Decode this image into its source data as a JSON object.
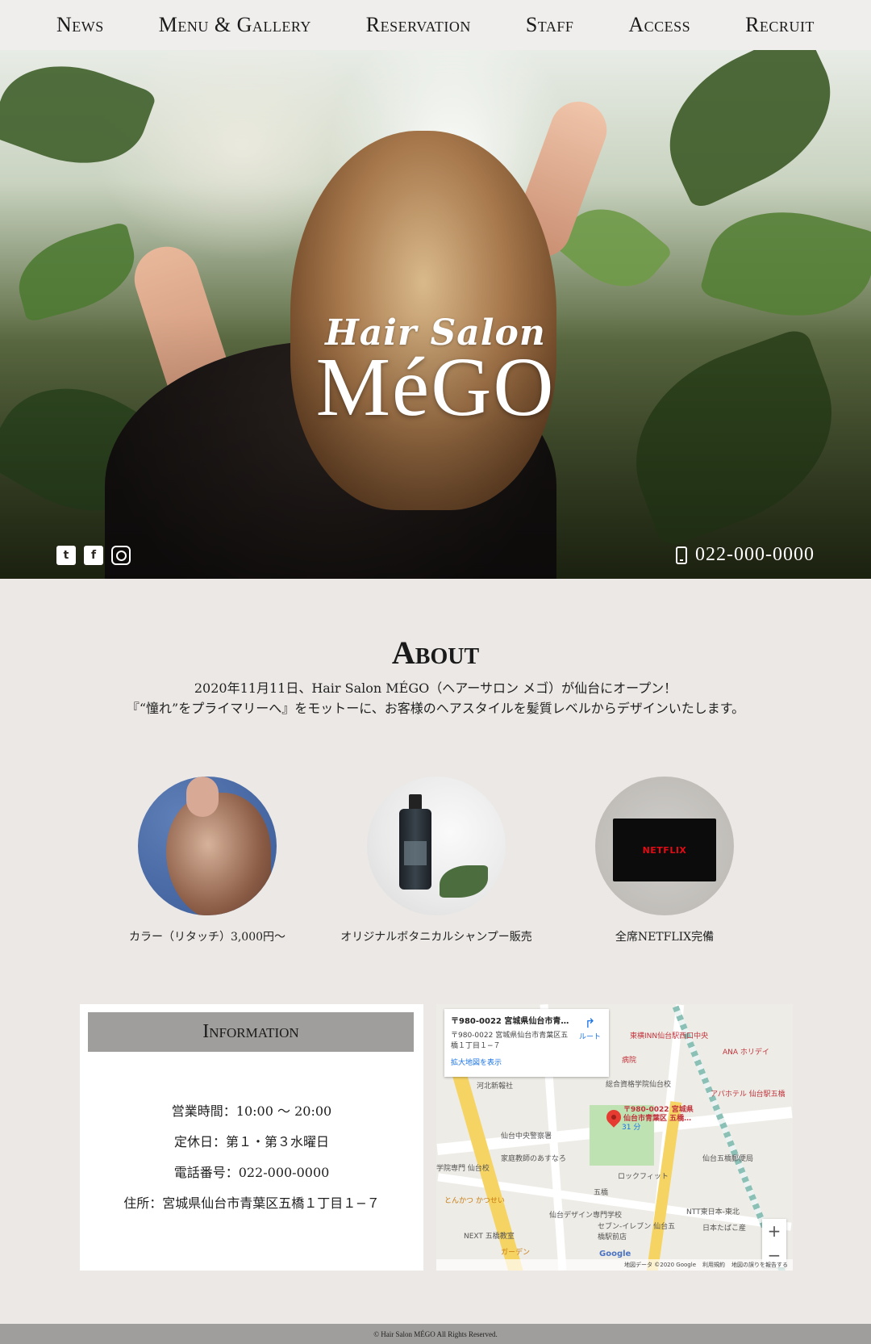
{
  "nav": {
    "items": [
      {
        "label": "News"
      },
      {
        "label": "Menu & Gallery"
      },
      {
        "label": "Reservation"
      },
      {
        "label": "Staff"
      },
      {
        "label": "Access"
      },
      {
        "label": "Recruit"
      }
    ]
  },
  "hero": {
    "logo_script": "Hair Salon",
    "logo_brand": "MéGO",
    "social_icons": [
      "twitter-icon",
      "facebook-icon",
      "instagram-icon"
    ],
    "phone": "022-000-0000"
  },
  "about": {
    "title": "About",
    "line1": "2020年11月11日、Hair Salon MÉGO（ヘアーサロン メゴ）が仙台にオープン！",
    "line2": "『“憧れ”をプライマリーへ』をモットーに、お客様のヘアスタイルを髪質レベルからデザインいたします。"
  },
  "features": [
    {
      "caption": "カラー（リタッチ）3,000円〜"
    },
    {
      "caption": "オリジナルボタニカルシャンプー販売"
    },
    {
      "caption": "全席NETFLIX完備",
      "tv_text": "NETFLIX"
    }
  ],
  "information": {
    "title": "Information",
    "hours": "営業時間：10:00 〜 20:00",
    "closed": "定休日：第１・第３水曜日",
    "phone": "電話番号：022-000-0000",
    "address": "住所：宮城県仙台市青葉区五橋１丁目１−７"
  },
  "map": {
    "card_title": "〒980-0022 宮城県仙台市青葉...",
    "card_address": "〒980-0022 宮城県仙台市青葉区五橋１丁目１−７",
    "card_link": "拡大地図を表示",
    "route_label": "ルート",
    "pin_label": "〒980-0022 宮城県仙台市青葉区 五橋…",
    "places": [
      "東横INN仙台駅西口中央",
      "ANA ホリデイ",
      "総合資格学院仙台校",
      "アパホテル 仙台駅五橋",
      "仙台中央警察署",
      "家庭教師のあすなろ",
      "仙台五橋郵便局",
      "ロックフィット",
      "五橋",
      "NTT東日本-東北",
      "とんかつ かつせい",
      "仙台デザイン専門学校",
      "セブン-イレブン 仙台五橋駅前店",
      "NEXT 五橋教室",
      "ガーデン",
      "日本たばこ産",
      "河北新報社",
      "学院専門 仙台校",
      "病院",
      "31 分"
    ],
    "google": "Google",
    "footer_data": "地図データ ©2020 Google",
    "footer_terms": "利用規約",
    "footer_report": "地図の誤りを報告する",
    "zoom_in": "+",
    "zoom_out": "−"
  },
  "footer": {
    "copyright": "© Hair Salon MÉGO All Rights Reserved."
  }
}
